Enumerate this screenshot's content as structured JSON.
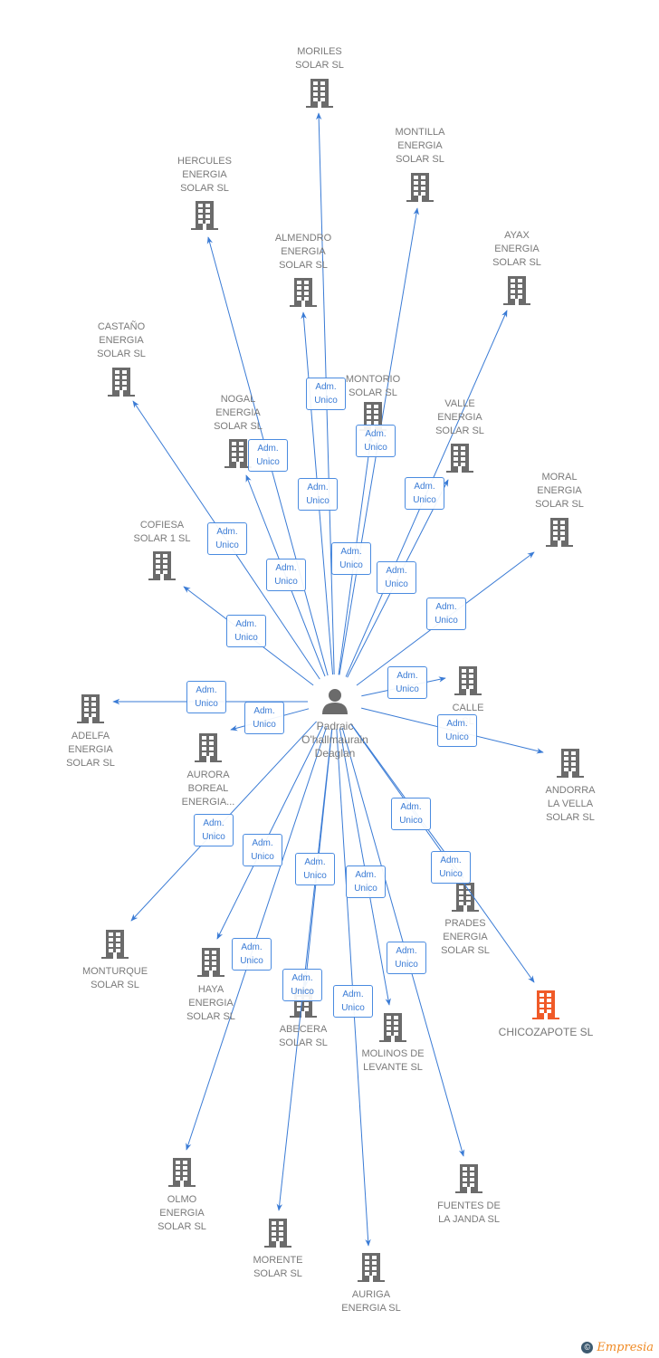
{
  "center": {
    "name_lines": [
      "Padraic",
      "O'hallmaurain",
      "Deaglan"
    ],
    "icon": "person-icon"
  },
  "relation_label": [
    "Adm.",
    "Unico"
  ],
  "colors": {
    "edge": "#3a7bd5",
    "node": "#6b6b6b",
    "highlight": "#f05a28"
  },
  "nodes": [
    {
      "lines": [
        "MORILES",
        "SOLAR SL"
      ]
    },
    {
      "lines": [
        "MONTILLA",
        "ENERGIA",
        "SOLAR SL"
      ]
    },
    {
      "lines": [
        "HERCULES",
        "ENERGIA",
        "SOLAR SL"
      ]
    },
    {
      "lines": [
        "AYAX",
        "ENERGIA",
        "SOLAR SL"
      ]
    },
    {
      "lines": [
        "ALMENDRO",
        "ENERGIA",
        "SOLAR SL"
      ]
    },
    {
      "lines": [
        "CASTAÑO",
        "ENERGIA",
        "SOLAR SL"
      ]
    },
    {
      "lines": [
        "MONTORIO",
        "SOLAR SL"
      ]
    },
    {
      "lines": [
        "NOGAL",
        "ENERGIA",
        "SOLAR SL"
      ]
    },
    {
      "lines": [
        "VALLE",
        "ENERGIA",
        "SOLAR SL"
      ]
    },
    {
      "lines": [
        "MORAL",
        "ENERGIA",
        "SOLAR SL"
      ]
    },
    {
      "lines": [
        "COFIESA",
        "SOLAR 1 SL"
      ]
    },
    {
      "lines": [
        "ADELFA",
        "ENERGIA",
        "SOLAR SL"
      ]
    },
    {
      "lines": [
        "CALLE",
        "SL"
      ]
    },
    {
      "lines": [
        "AURORA",
        "BOREAL",
        "ENERGIA..."
      ]
    },
    {
      "lines": [
        "ANDORRA",
        "LA VELLA",
        "SOLAR SL"
      ]
    },
    {
      "lines": [
        "PRADES",
        "ENERGIA",
        "SOLAR SL"
      ]
    },
    {
      "lines": [
        "CHICOZAPOTE SL"
      ],
      "highlight": true
    },
    {
      "lines": [
        "MONTURQUE",
        "SOLAR SL"
      ]
    },
    {
      "lines": [
        "HAYA",
        "ENERGIA",
        "SOLAR SL"
      ]
    },
    {
      "lines": [
        "ABECERA",
        "SOLAR SL"
      ]
    },
    {
      "lines": [
        "MOLINOS DE",
        "LEVANTE SL"
      ]
    },
    {
      "lines": [
        "OLMO",
        "ENERGIA",
        "SOLAR SL"
      ]
    },
    {
      "lines": [
        "FUENTES DE",
        "LA JANDA SL"
      ]
    },
    {
      "lines": [
        "MORENTE",
        "SOLAR SL"
      ]
    },
    {
      "lines": [
        "AURIGA",
        "ENERGIA SL"
      ]
    }
  ],
  "brand": {
    "name": "Empresia",
    "symbol": "©"
  }
}
